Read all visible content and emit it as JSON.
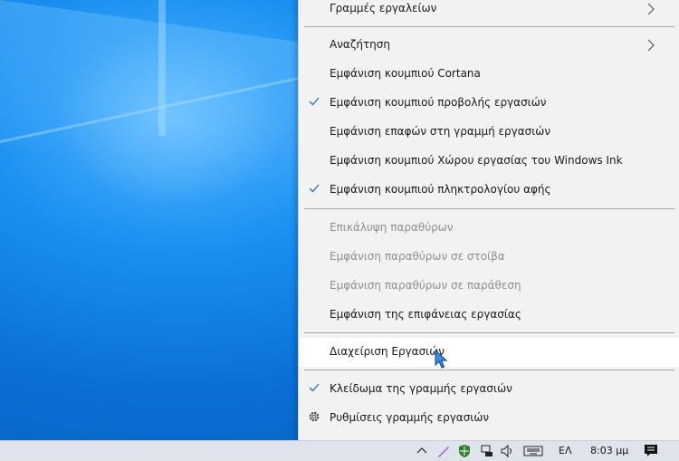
{
  "menu": {
    "toolbars": "Γραμμές εργαλείων",
    "search": "Αναζήτηση",
    "show_cortana": "Εμφάνιση κουμπιού Cortana",
    "show_task_view": "Εμφάνιση κουμπιού προβολής εργασιών",
    "show_people": "Εμφάνιση επαφών στη γραμμή εργασιών",
    "show_ink": "Εμφάνιση κουμπιού Χώρου εργασίας του Windows Ink",
    "show_touch_keyboard": "Εμφάνιση κουμπιού πληκτρολογίου αφής",
    "cascade": "Επικάλυψη παραθύρων",
    "stacked": "Εμφάνιση παραθύρων σε στοίβα",
    "side_by_side": "Εμφάνιση παραθύρων σε παράθεση",
    "show_desktop": "Εμφάνιση της επιφάνειας εργασίας",
    "task_manager": "Διαχείριση Εργασιών",
    "lock_taskbar": "Κλείδωμα της γραμμής εργασιών",
    "taskbar_settings": "Ρυθμίσεις γραμμής εργασιών"
  },
  "taskbar": {
    "language": "ΕΛ",
    "time": "8:03 μμ"
  },
  "colors": {
    "menu_bg": "#f2f2f2",
    "check_color": "#2b6cb0",
    "disabled_text": "#8f8f8f"
  }
}
